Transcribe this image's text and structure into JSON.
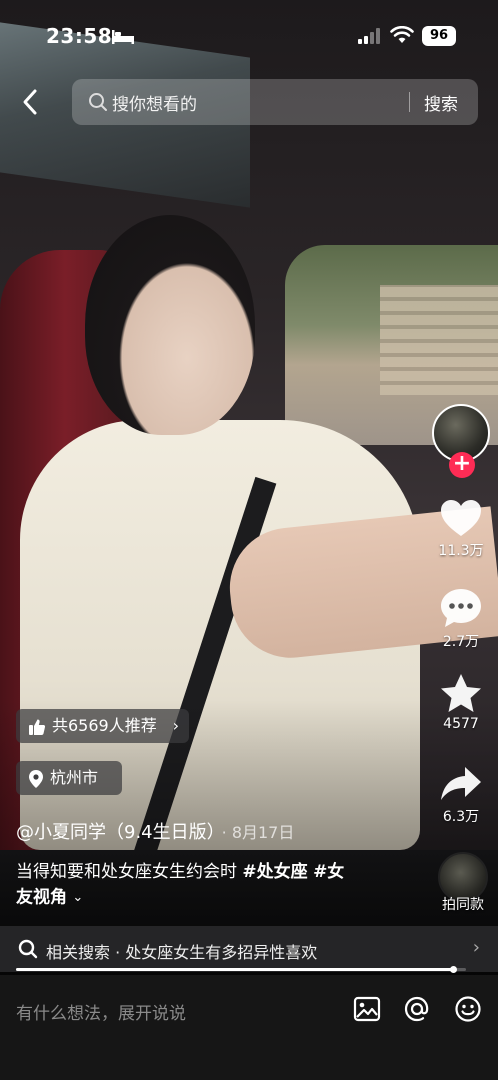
{
  "status_bar": {
    "time": "23:58",
    "battery": "96",
    "icons": [
      "sleep-mode-icon",
      "cellular-signal-icon",
      "wifi-icon",
      "battery-icon"
    ]
  },
  "search": {
    "placeholder": "搜你想看的",
    "button_label": "搜索"
  },
  "actions": {
    "likes": "11.3万",
    "comments": "2.7万",
    "favorites": "4577",
    "shares": "6.3万",
    "follow_symbol": "+"
  },
  "post": {
    "recommend_chip": "共6569人推荐",
    "location": "杭州市",
    "author": "@小夏同学（9.4生日版）",
    "date": "· 8月17日",
    "caption_text": "当得知要和处女座女生约会时 ",
    "tags": [
      "#处女座",
      "#女友视角"
    ],
    "tag_2_part1": "#女",
    "tag_2_part2": "友视角",
    "same_style_label": "拍同款"
  },
  "related_search": {
    "prefix": "相关搜索 · ",
    "query": "处女座女生有多招异性喜欢"
  },
  "playback": {
    "progress": 0.97
  },
  "comment_bar": {
    "placeholder": "有什么想法，展开说说",
    "icons": [
      "image-icon",
      "mention-icon",
      "emoji-icon"
    ]
  },
  "colors": {
    "accent": "#fe2c55",
    "chip_bg": "#3c3c3e",
    "bottom_bar": "#161616"
  }
}
